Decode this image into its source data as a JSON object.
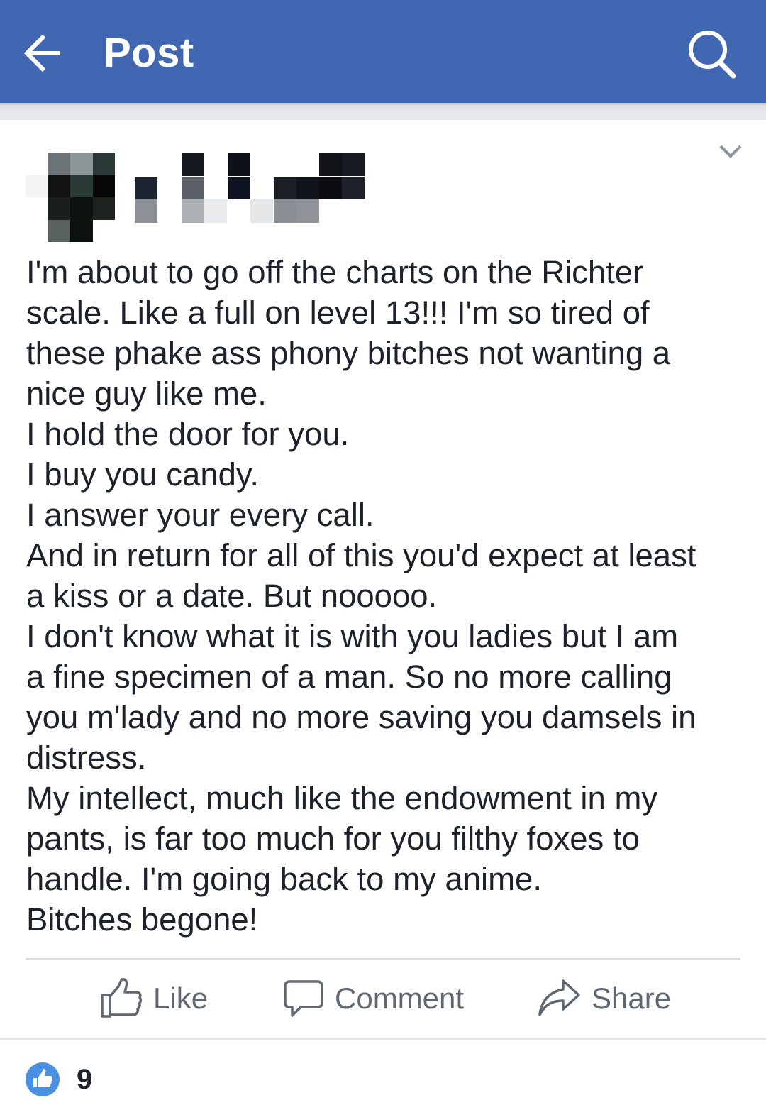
{
  "header": {
    "title": "Post",
    "back_icon": "arrow-left-icon",
    "search_icon": "search-icon",
    "background": "#4267b2"
  },
  "post": {
    "author": "",
    "menu_icon": "chevron-down-icon",
    "body": "I'm about to go off the charts on the Richter\nscale. Like a full on level 13!!! I'm so tired of\nthese phake ass phony bitches not wanting a\nnice guy like me.\nI hold the door for you.\nI buy you candy.\nI answer your every call.\nAnd in return for all of this you'd expect at least\na kiss or a date. But nooooo.\nI don't know what it is with you ladies but I am\na fine specimen of a man. So no more calling\nyou m'lady and no more saving you damsels in\ndistress.\nMy intellect, much like the endowment in my\npants, is far too much for you filthy foxes to\nhandle. I'm going back to my anime.\nBitches begone!"
  },
  "actions": {
    "like": "Like",
    "comment": "Comment",
    "share": "Share"
  },
  "reactions": {
    "count": "9",
    "icon": "like-reaction-icon",
    "color": "#4a90e2"
  }
}
